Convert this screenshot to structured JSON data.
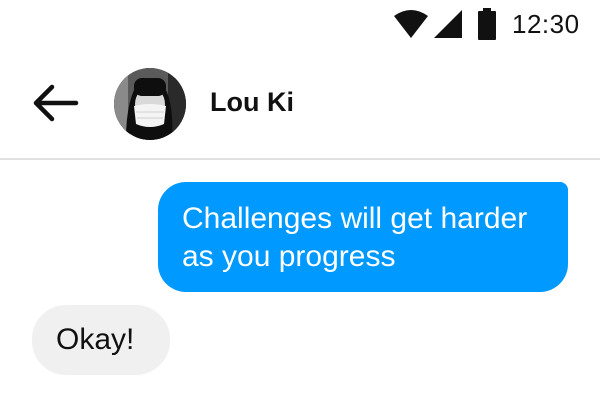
{
  "status_bar": {
    "time": "12:30",
    "icons": [
      "wifi-icon",
      "cellular-signal-icon",
      "battery-icon"
    ]
  },
  "header": {
    "back_icon": "back-arrow-icon",
    "contact_name": "Lou Ki",
    "avatar": "contact-avatar"
  },
  "messages": [
    {
      "direction": "outgoing",
      "text": "Challenges will get harder as you progress"
    },
    {
      "direction": "incoming",
      "text": "Okay!"
    }
  ],
  "colors": {
    "outgoing_bubble": "#0099ff",
    "incoming_bubble": "#f0f0f0",
    "divider": "#e2e2e2"
  }
}
